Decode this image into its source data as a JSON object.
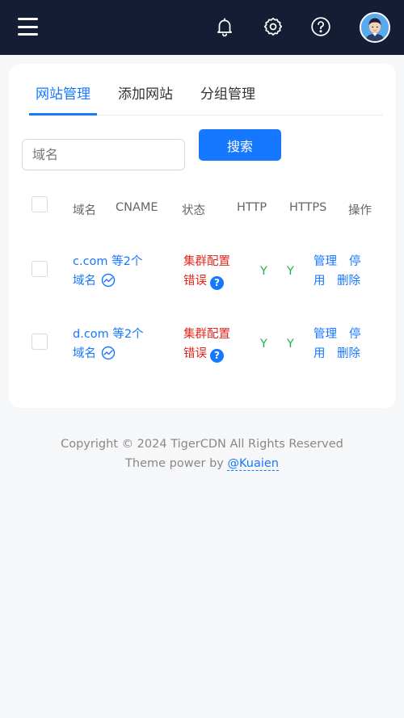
{
  "topbar": {
    "menu_icon": "hamburger-menu-icon",
    "icons": [
      "bell-icon",
      "gear-icon",
      "help-circle-icon"
    ],
    "avatar_icon": "user-avatar"
  },
  "tabs": [
    {
      "label": "网站管理",
      "active": true
    },
    {
      "label": "添加网站",
      "active": false
    },
    {
      "label": "分组管理",
      "active": false
    }
  ],
  "search": {
    "placeholder": "域名",
    "value": "",
    "button_label": "搜索"
  },
  "table": {
    "headers": [
      "域名",
      "CNAME",
      "状态",
      "HTTP",
      "HTTPS",
      "操作"
    ],
    "rows": [
      {
        "domain_line1": "c.com 等2个",
        "domain_line2": "域名",
        "status_line1": "集群配置",
        "status_line2": "错误",
        "http": "Y",
        "https": "Y",
        "action_manage": "管理",
        "action_stop_a": "停",
        "action_stop_b": "用",
        "action_delete": "删除"
      },
      {
        "domain_line1": "d.com 等2个",
        "domain_line2": "域名",
        "status_line1": "集群配置",
        "status_line2": "错误",
        "http": "Y",
        "https": "Y",
        "action_manage": "管理",
        "action_stop_a": "停",
        "action_stop_b": "用",
        "action_delete": "删除"
      }
    ]
  },
  "footer": {
    "copyright": "Copyright © 2024 TigerCDN All Rights Reserved",
    "theme_prefix": "Theme power by",
    "theme_link": "@Kuaien"
  },
  "colors": {
    "topbar": "#141d33",
    "accent": "#1677ff",
    "error": "#e0261d",
    "success": "#19b44b"
  }
}
